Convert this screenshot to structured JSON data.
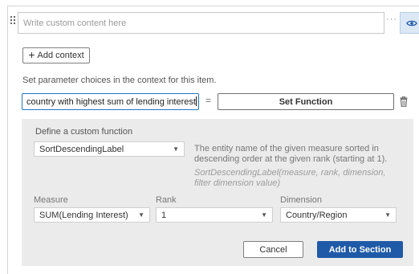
{
  "content": {
    "placeholder": "Write custom content here",
    "more": "···"
  },
  "context": {
    "add_label": "Add context",
    "hint": "Set parameter choices in the context for this item.",
    "value": "country with highest sum of lending interest",
    "equals": "=",
    "set_function_label": "Set Function"
  },
  "custom_function": {
    "title": "Define a custom function",
    "function": {
      "selected": "SortDescendingLabel"
    },
    "description": "The entity name of the given measure sorted in descending order at the given rank (starting at 1).",
    "signature": "SortDescendingLabel(measure, rank, dimension, filter dimension value)",
    "measure": {
      "label": "Measure",
      "selected": "SUM(Lending Interest)"
    },
    "rank": {
      "label": "Rank",
      "selected": "1"
    },
    "dimension": {
      "label": "Dimension",
      "selected": "Country/Region"
    },
    "cancel_label": "Cancel",
    "add_label": "Add to Section"
  },
  "icons": {
    "drag": "drag-handle-icon",
    "eye": "eye-icon",
    "trash": "trash-icon",
    "plus": "plus-icon",
    "chevron": "chevron-down-icon"
  },
  "colors": {
    "accent": "#1f5aa8",
    "focus": "#1f77c9",
    "panel": "#ebebeb"
  }
}
